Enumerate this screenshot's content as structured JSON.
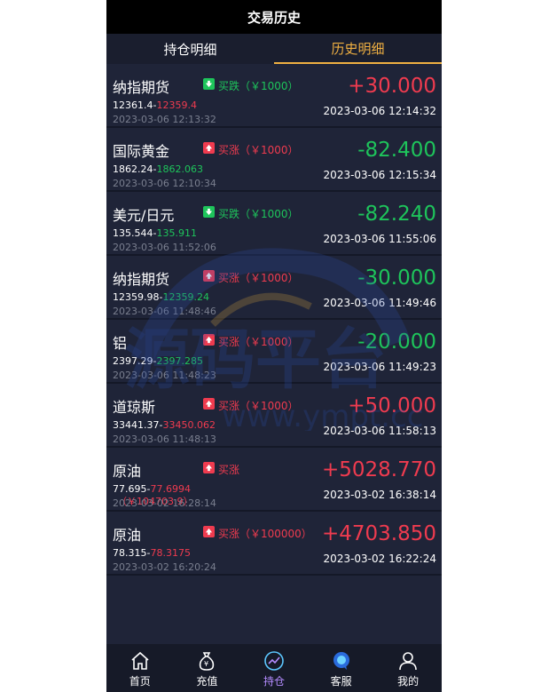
{
  "title": "交易历史",
  "tabs": [
    {
      "label": "持仓明细",
      "active": false
    },
    {
      "label": "历史明细",
      "active": true
    }
  ],
  "records": [
    {
      "name": "纳指期货",
      "direction": "down",
      "direction_label": "买跌（￥1000）",
      "open_price": "12361.4",
      "close_price": "12359.4",
      "close_color": "red",
      "open_time": "2023-03-06 12:13:32",
      "profit": "+30.000",
      "profit_color": "red",
      "close_time": "2023-03-06 12:14:32",
      "amount_line": ""
    },
    {
      "name": "国际黄金",
      "direction": "up",
      "direction_label": "买涨（￥1000）",
      "open_price": "1862.24",
      "close_price": "1862.063",
      "close_color": "green",
      "open_time": "2023-03-06 12:10:34",
      "profit": "-82.400",
      "profit_color": "green",
      "close_time": "2023-03-06 12:15:34",
      "amount_line": ""
    },
    {
      "name": "美元/日元",
      "direction": "down",
      "direction_label": "买跌（￥1000）",
      "open_price": "135.544",
      "close_price": "135.911",
      "close_color": "green",
      "open_time": "2023-03-06 11:52:06",
      "profit": "-82.240",
      "profit_color": "green",
      "close_time": "2023-03-06 11:55:06",
      "amount_line": ""
    },
    {
      "name": "纳指期货",
      "direction": "up",
      "direction_label": "买涨（￥1000）",
      "open_price": "12359.98",
      "close_price": "12359.24",
      "close_color": "green",
      "open_time": "2023-03-06 11:48:46",
      "profit": "-30.000",
      "profit_color": "green",
      "close_time": "2023-03-06 11:49:46",
      "amount_line": ""
    },
    {
      "name": "铝",
      "direction": "up",
      "direction_label": "买涨（￥1000）",
      "open_price": "2397.29",
      "close_price": "2397.285",
      "close_color": "green",
      "open_time": "2023-03-06 11:48:23",
      "profit": "-20.000",
      "profit_color": "green",
      "close_time": "2023-03-06 11:49:23",
      "amount_line": ""
    },
    {
      "name": "道琼斯",
      "direction": "up",
      "direction_label": "买涨（￥1000）",
      "open_price": "33441.37",
      "close_price": "33450.062",
      "close_color": "red",
      "open_time": "2023-03-06 11:48:13",
      "profit": "+50.000",
      "profit_color": "red",
      "close_time": "2023-03-06 11:58:13",
      "amount_line": ""
    },
    {
      "name": "原油",
      "direction": "up",
      "direction_label": "买涨",
      "open_price": "77.695",
      "close_price": "77.6994",
      "close_color": "red",
      "open_time": "2023-03-02 16:28:14",
      "profit": "+5028.770",
      "profit_color": "red",
      "close_time": "2023-03-02 16:38:14",
      "amount_line": "（￥104703.9）"
    },
    {
      "name": "原油",
      "direction": "up",
      "direction_label": "买涨（￥100000）",
      "open_price": "78.315",
      "close_price": "78.3175",
      "close_color": "red",
      "open_time": "2023-03-02 16:20:24",
      "profit": "+4703.850",
      "profit_color": "red",
      "close_time": "2023-03-02 16:22:24",
      "amount_line": ""
    }
  ],
  "watermark": {
    "text": "源码平台",
    "url": "www.ympt.cc"
  },
  "nav": [
    {
      "label": "首页",
      "icon": "home-icon",
      "active": false
    },
    {
      "label": "充值",
      "icon": "money-bag-icon",
      "active": false
    },
    {
      "label": "持仓",
      "icon": "chart-icon",
      "active": true
    },
    {
      "label": "客服",
      "icon": "service-icon",
      "active": false
    },
    {
      "label": "我的",
      "icon": "user-icon",
      "active": false
    }
  ],
  "colors": {
    "up": "#ef3b4f",
    "down": "#1ec45b",
    "accent": "#f0b042",
    "nav_active": "#b48cff",
    "background": "#1f2438"
  }
}
